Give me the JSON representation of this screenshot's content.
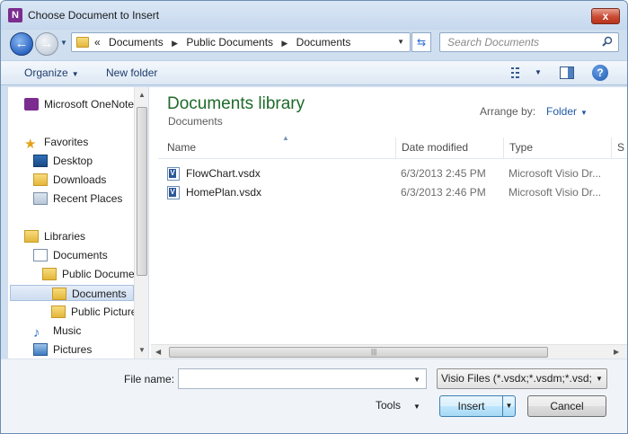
{
  "window": {
    "title": "Choose Document to Insert",
    "app_icon_glyph": "N",
    "close_glyph": "x"
  },
  "nav": {
    "breadcrumb": [
      "Documents",
      "Public Documents",
      "Documents"
    ],
    "breadcrumb_lead": "«",
    "search_placeholder": "Search Documents"
  },
  "toolbar": {
    "organize": "Organize",
    "new_folder": "New folder",
    "help_glyph": "?"
  },
  "sidebar": {
    "items": [
      {
        "label": "Microsoft OneNote",
        "icon": "onenote-icon"
      },
      {
        "label": "Favorites",
        "icon": "star-icon"
      },
      {
        "label": "Desktop",
        "icon": "desktop-icon"
      },
      {
        "label": "Downloads",
        "icon": "downloads-icon"
      },
      {
        "label": "Recent Places",
        "icon": "recent-places-icon"
      },
      {
        "label": "Libraries",
        "icon": "libraries-icon"
      },
      {
        "label": "Documents",
        "icon": "documents-icon"
      },
      {
        "label": "Public Docume",
        "icon": "folder-icon"
      },
      {
        "label": "Documents",
        "icon": "folder-icon",
        "selected": true
      },
      {
        "label": "Public Picture",
        "icon": "folder-icon"
      },
      {
        "label": "Music",
        "icon": "music-icon"
      },
      {
        "label": "Pictures",
        "icon": "pictures-icon"
      }
    ]
  },
  "library": {
    "title": "Documents library",
    "subtitle": "Documents",
    "arrange_label": "Arrange by:",
    "arrange_value": "Folder"
  },
  "columns": [
    "Name",
    "Date modified",
    "Type",
    "S"
  ],
  "files": [
    {
      "name": "FlowChart.vsdx",
      "date": "6/3/2013 2:45 PM",
      "type": "Microsoft Visio Dr..."
    },
    {
      "name": "HomePlan.vsdx",
      "date": "6/3/2013 2:46 PM",
      "type": "Microsoft Visio Dr..."
    }
  ],
  "footer": {
    "file_name_label": "File name:",
    "file_name_value": "",
    "filter": "Visio Files (*.vsdx;*.vsdm;*.vsd;*",
    "tools": "Tools",
    "insert": "Insert",
    "cancel": "Cancel"
  }
}
